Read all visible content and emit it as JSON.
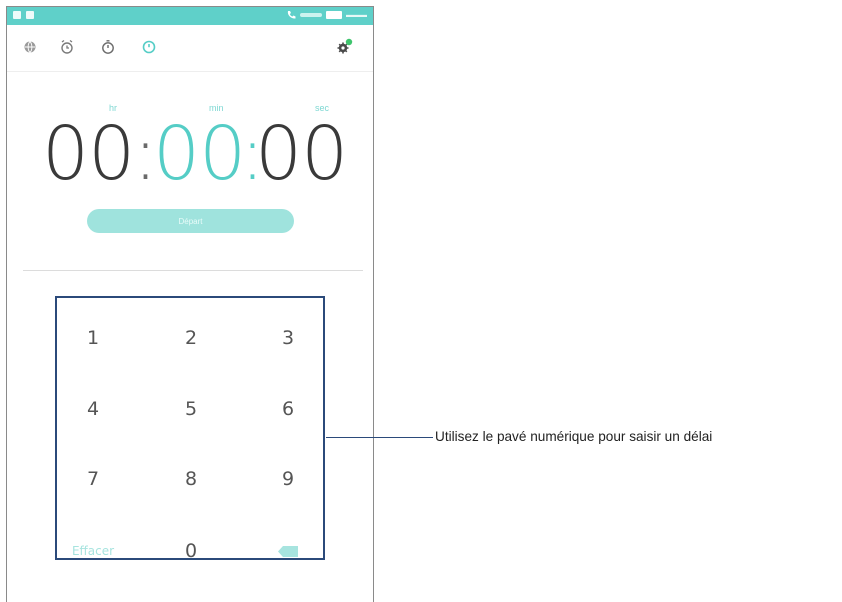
{
  "app": {
    "toolbar": {
      "icons": [
        "world-clock-icon",
        "alarm-icon",
        "stopwatch-icon",
        "timer-icon",
        "settings-icon"
      ]
    },
    "time_labels": {
      "hours": "hr",
      "minutes": "min",
      "seconds": "sec"
    },
    "time": {
      "hours": "00",
      "minutes": "00",
      "seconds": "00"
    },
    "start_button": "Départ",
    "keypad": {
      "keys": [
        "1",
        "2",
        "3",
        "4",
        "5",
        "6",
        "7",
        "8",
        "9"
      ],
      "clear": "Effacer",
      "zero": "0",
      "backspace_icon": "backspace-icon"
    }
  },
  "annotation": {
    "text": "Utilisez le pavé numérique pour saisir un délai"
  },
  "colors": {
    "accent": "#55cdc6",
    "statusbar": "#5fd0c9",
    "callout": "#2b4a7a"
  }
}
